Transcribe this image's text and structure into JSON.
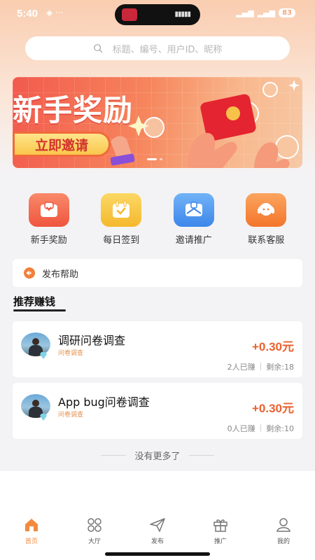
{
  "status_bar": {
    "time": "5:40",
    "battery": "83"
  },
  "search": {
    "placeholder": "标题、编号、用户ID、昵称"
  },
  "banner": {
    "title": "新手奖励",
    "button_label": "立即邀请"
  },
  "quick_actions": [
    {
      "label": "新手奖励",
      "icon": "gift-box-icon",
      "color": "#f46a4a"
    },
    {
      "label": "每日签到",
      "icon": "calendar-check-icon",
      "color": "#f7c13b"
    },
    {
      "label": "邀请推广",
      "icon": "envelope-icon",
      "color": "#4e9af0"
    },
    {
      "label": "联系客服",
      "icon": "customer-service-icon",
      "color": "#f6883a"
    }
  ],
  "help_bar": {
    "label": "发布帮助"
  },
  "section": {
    "title": "推荐赚钱"
  },
  "tasks": [
    {
      "title": "调研问卷调查",
      "tag": "问卷调查",
      "reward": "+0.30元",
      "earned": "2人已赚",
      "remaining": "剩余:18"
    },
    {
      "title": "App bug问卷调查",
      "tag": "问卷调查",
      "reward": "+0.30元",
      "earned": "0人已赚",
      "remaining": "剩余:10"
    }
  ],
  "footer_note": "没有更多了",
  "tabbar": [
    {
      "label": "首页",
      "icon": "home-icon",
      "active": true
    },
    {
      "label": "大厅",
      "icon": "grid-icon",
      "active": false
    },
    {
      "label": "发布",
      "icon": "send-icon",
      "active": false
    },
    {
      "label": "推广",
      "icon": "gift-icon",
      "active": false
    },
    {
      "label": "我的",
      "icon": "user-icon",
      "active": false
    }
  ],
  "colors": {
    "accent": "#f28a3f",
    "reward": "#e9612e"
  }
}
